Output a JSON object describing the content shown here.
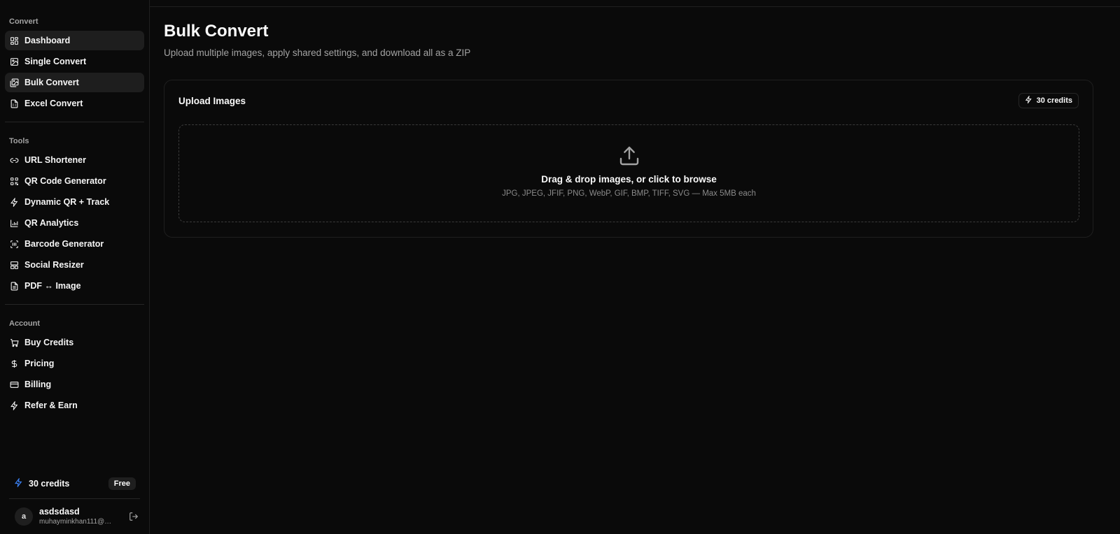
{
  "sidebar": {
    "sections": {
      "convert": "Convert",
      "tools": "Tools",
      "account": "Account"
    },
    "convert_items": [
      {
        "label": "Dashboard",
        "icon": "dashboard-icon"
      },
      {
        "label": "Single Convert",
        "icon": "image-icon"
      },
      {
        "label": "Bulk Convert",
        "icon": "images-icon",
        "active": true
      },
      {
        "label": "Excel Convert",
        "icon": "file-spreadsheet-icon"
      }
    ],
    "tool_items": [
      {
        "label": "URL Shortener",
        "icon": "link-icon"
      },
      {
        "label": "QR Code Generator",
        "icon": "qr-code-icon"
      },
      {
        "label": "Dynamic QR + Track",
        "icon": "zap-icon"
      },
      {
        "label": "QR Analytics",
        "icon": "bar-chart-icon"
      },
      {
        "label": "Barcode Generator",
        "icon": "barcode-icon"
      },
      {
        "label": "Social Resizer",
        "icon": "layout-icon"
      },
      {
        "label": "PDF ↔ Image",
        "icon": "file-icon"
      }
    ],
    "account_items": [
      {
        "label": "Buy Credits",
        "icon": "cart-icon"
      },
      {
        "label": "Pricing",
        "icon": "dollar-icon"
      },
      {
        "label": "Billing",
        "icon": "credit-card-icon"
      },
      {
        "label": "Refer & Earn",
        "icon": "zap-icon"
      }
    ],
    "credits": {
      "label": "30 credits",
      "plan": "Free",
      "accent": "#3b82f6"
    },
    "user": {
      "initial": "a",
      "name": "asdsdasd",
      "email": "muhayminkhan111@g..."
    }
  },
  "page": {
    "title": "Bulk Convert",
    "subtitle": "Upload multiple images, apply shared settings, and download all as a ZIP"
  },
  "upload_card": {
    "title": "Upload Images",
    "credits_chip": "30 credits",
    "drop_title": "Drag & drop images, or click to browse",
    "drop_hint": "JPG, JPEG, JFIF, PNG, WebP, GIF, BMP, TIFF, SVG — Max 5MB each"
  }
}
